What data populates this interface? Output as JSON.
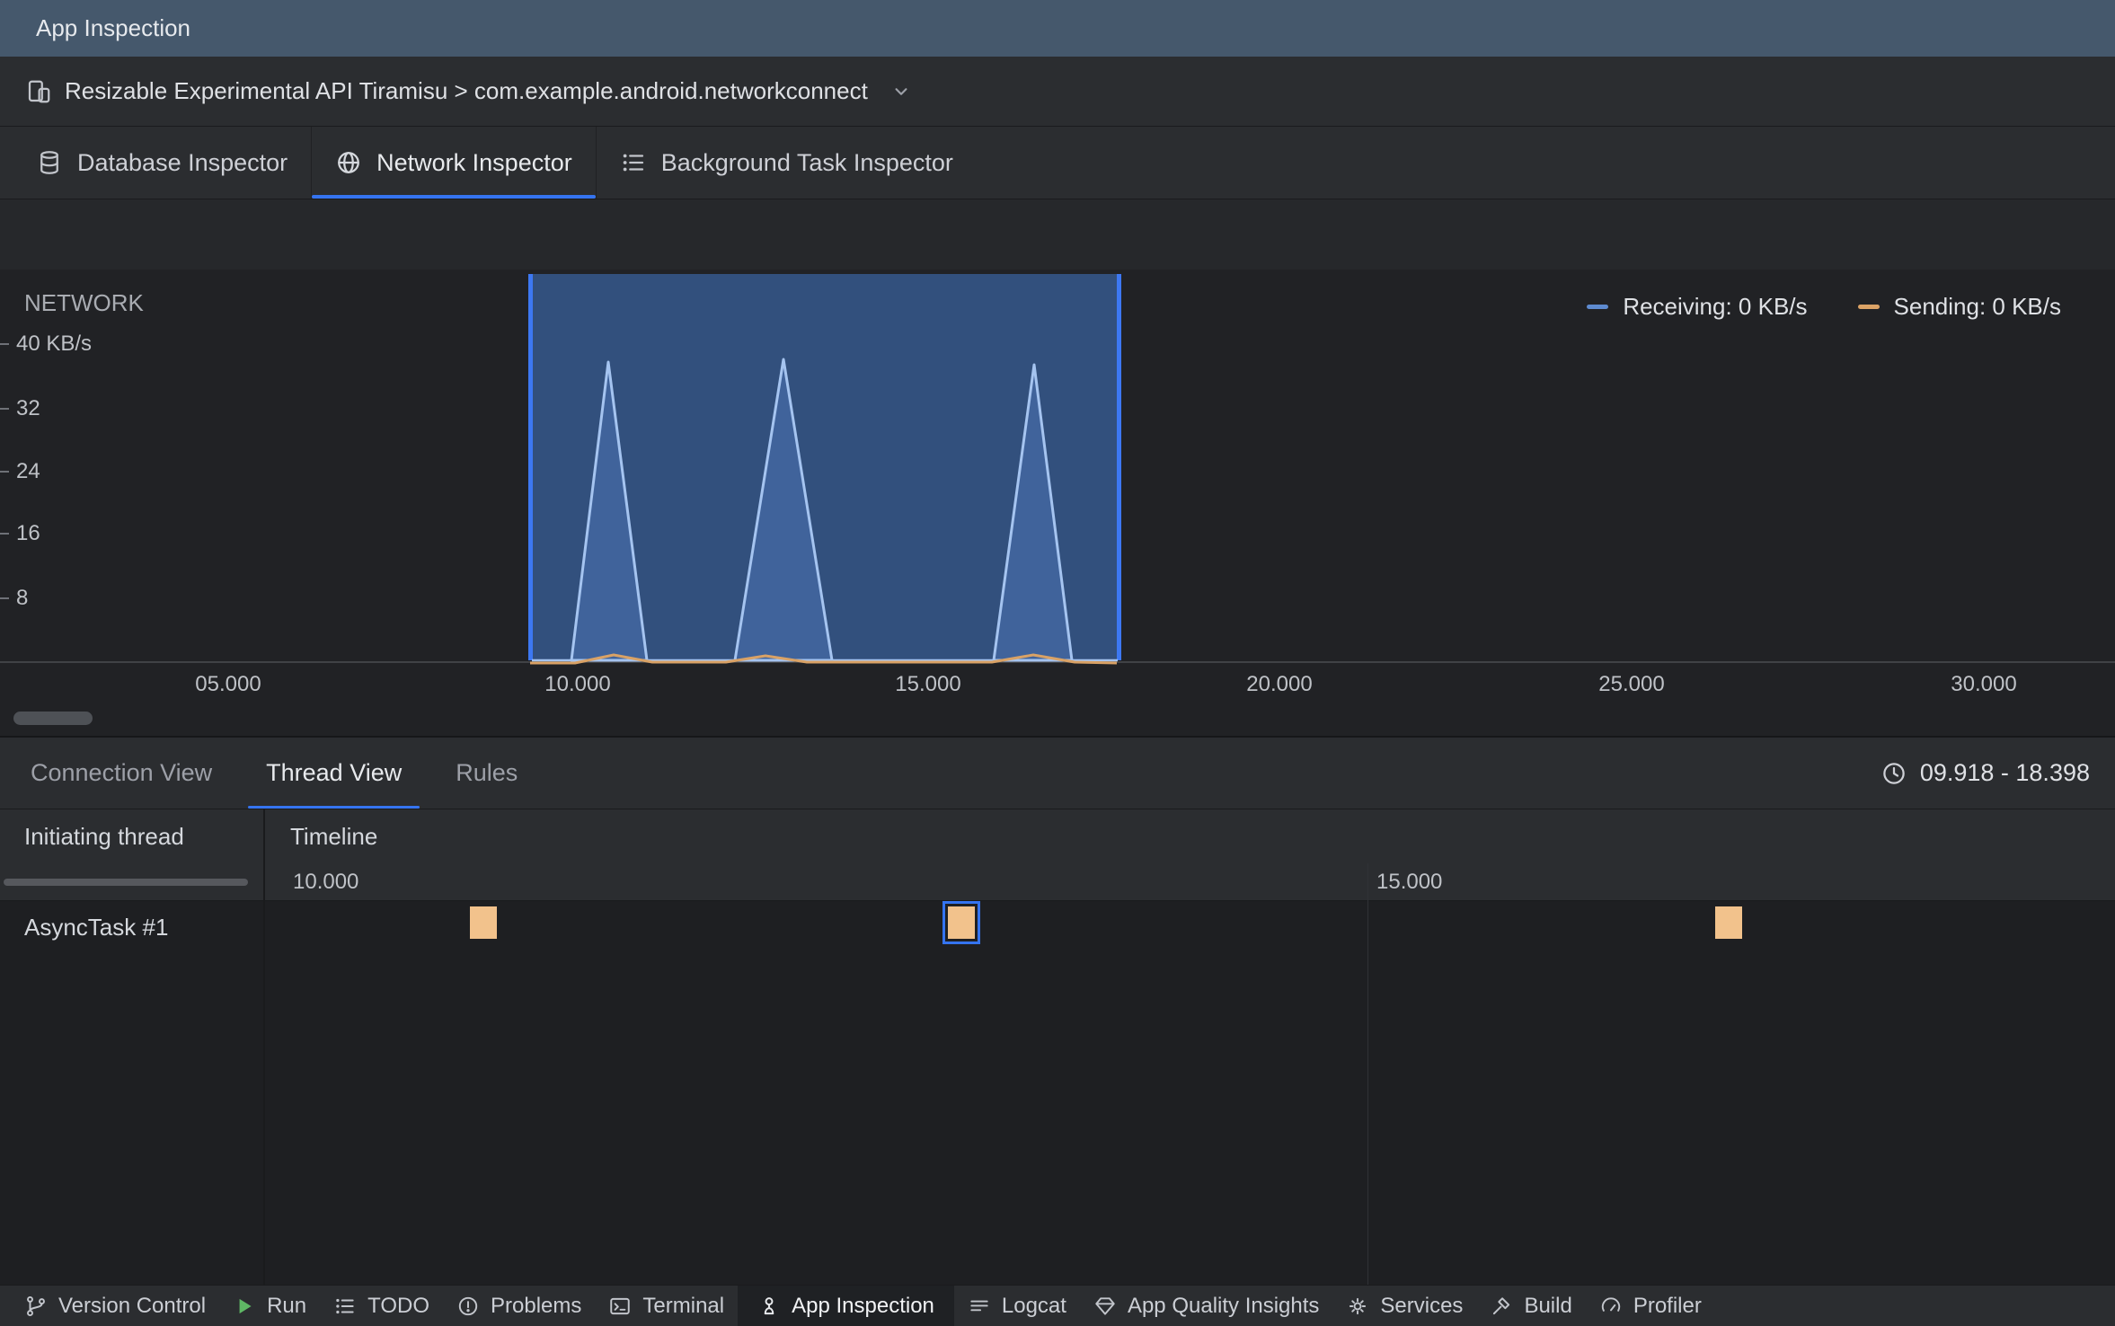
{
  "titlebar": {
    "title": "App Inspection"
  },
  "device_bar": {
    "selector_label": "Resizable Experimental API Tiramisu > com.example.android.networkconnect"
  },
  "inspector_tabs": {
    "database": {
      "label": "Database Inspector"
    },
    "network": {
      "label": "Network Inspector"
    },
    "background": {
      "label": "Background Task Inspector"
    }
  },
  "network_panel": {
    "title": "NETWORK",
    "legend": {
      "receiving": "Receiving: 0 KB/s",
      "sending": "Sending: 0 KB/s"
    },
    "y_ticks": [
      "40 KB/s",
      "32",
      "24",
      "16",
      "8"
    ],
    "x_ticks": [
      "05.000",
      "10.000",
      "15.000",
      "20.000",
      "25.000",
      "30.000"
    ]
  },
  "chart_data": {
    "type": "area",
    "title": "NETWORK",
    "ylabel": "KB/s",
    "ylim": [
      0,
      44
    ],
    "y_ticks": [
      8,
      16,
      24,
      32,
      40
    ],
    "x_unit": "seconds",
    "x_ticks": [
      "05.000",
      "10.000",
      "15.000",
      "20.000",
      "25.000",
      "30.000"
    ],
    "selection_seconds": {
      "start": 9.918,
      "end": 18.398
    },
    "legend_position": "top-right",
    "series": [
      {
        "name": "Receiving",
        "current": "0 KB/s",
        "color": "#5E8BD0",
        "spikes": [
          {
            "t": 10.6,
            "peak_kbps": 38
          },
          {
            "t": 13.1,
            "peak_kbps": 38.5
          },
          {
            "t": 16.7,
            "peak_kbps": 38
          }
        ]
      },
      {
        "name": "Sending",
        "current": "0 KB/s",
        "color": "#DCA366",
        "spikes": [
          {
            "t": 10.8,
            "peak_kbps": 2
          },
          {
            "t": 13.3,
            "peak_kbps": 2
          },
          {
            "t": 16.9,
            "peak_kbps": 2
          }
        ]
      }
    ]
  },
  "detail_tabs": {
    "connection": {
      "label": "Connection View"
    },
    "thread": {
      "label": "Thread View"
    },
    "rules": {
      "label": "Rules"
    },
    "time_range": "09.918 - 18.398"
  },
  "thread_table": {
    "columns": {
      "thread": "Initiating thread",
      "timeline": "Timeline"
    },
    "time_ticks": [
      "10.000",
      "15.000"
    ],
    "rows": [
      {
        "thread": "AsyncTask #1",
        "events": [
          {
            "t": 10.5,
            "selected": false
          },
          {
            "t": 13.0,
            "selected": true
          },
          {
            "t": 16.4,
            "selected": false
          }
        ]
      }
    ]
  },
  "status_bar": {
    "items": [
      {
        "label": "Version Control"
      },
      {
        "label": "Run"
      },
      {
        "label": "TODO"
      },
      {
        "label": "Problems"
      },
      {
        "label": "Terminal"
      },
      {
        "label": "App Inspection",
        "active": true
      },
      {
        "label": "Logcat"
      },
      {
        "label": "App Quality Insights"
      },
      {
        "label": "Services"
      },
      {
        "label": "Build"
      },
      {
        "label": "Profiler"
      }
    ]
  },
  "colors": {
    "accent": "#3574F0",
    "titlebar_bg": "#45586C",
    "selection_fill": "#32507D",
    "selection_edge": "#3D78F2",
    "receiving_line": "#A5C4F0",
    "sending_line": "#D9A266",
    "event_marker": "#F2C28C",
    "run_green": "#5FB865"
  }
}
